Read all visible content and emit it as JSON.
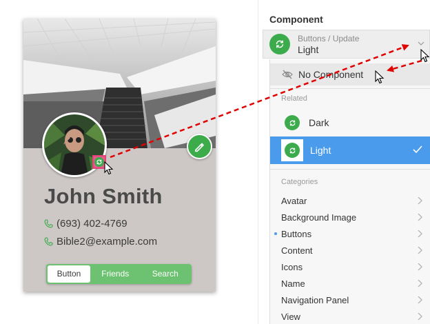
{
  "card": {
    "name": "John Smith",
    "phone": "(693) 402-4769",
    "email": "Bible2@example.com",
    "tabs": [
      "Button",
      "Friends",
      "Search"
    ],
    "active_tab": "Button"
  },
  "panel": {
    "title": "Component",
    "selected_path": "Buttons / Update",
    "selected_value": "Light",
    "no_component_label": "No Component",
    "related_label": "Related",
    "related_items": [
      "Dark",
      "Light"
    ],
    "selected_related": "Light",
    "categories_label": "Categories",
    "categories": [
      "Avatar",
      "Background Image",
      "Buttons",
      "Content",
      "Icons",
      "Name",
      "Navigation Panel",
      "View"
    ],
    "active_category": "Buttons"
  },
  "colors": {
    "accent_green": "#3cab4a",
    "tab_green": "#6cc270",
    "selection_blue": "#4a9bec",
    "arrow_red": "#e00000",
    "highlight_pink": "#e0457a"
  },
  "icons": {
    "phone": "phone-icon",
    "edit": "pencil-icon",
    "update": "refresh-icon",
    "hidden": "eye-slash-icon",
    "check": "check-icon",
    "chevron": "chevron-right-icon"
  }
}
